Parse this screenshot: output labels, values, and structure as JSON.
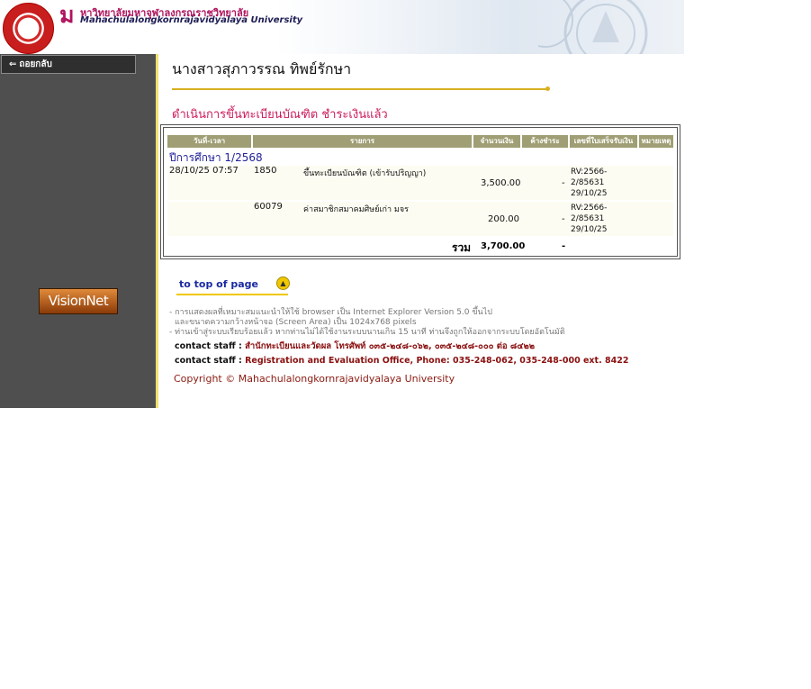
{
  "header": {
    "logo_mark": "ม",
    "university_thai": "หาวิทยาลัยมหาจุฬาลงกรณราชวิทยาลัย",
    "university_en": "Mahachulalongkornrajavidyalaya University"
  },
  "sidebar": {
    "back_label": "ถอยกลับ",
    "vision_label": "VisionNet"
  },
  "main": {
    "student_name": "นางสาวสุภาวรรณ ทิพย์รักษา",
    "status_title": "ดำเนินการขึ้นทะเบียนบัณฑิต ชำระเงินแล้ว"
  },
  "table": {
    "headers": [
      "วันที่-เวลา",
      "รายการ",
      "จำนวนเงิน",
      "ค้างชำระ",
      "เลขที่ใบเสร็จรับเงิน",
      "หมายเหตุ"
    ],
    "academic_year": "ปีการศึกษา 1/2568",
    "rows": [
      {
        "datetime": "28/10/25 07:57",
        "code": "1850",
        "description": "ขึ้นทะเบียนบัณฑิต (เข้ารับปริญญา)",
        "amount": "3,500.00",
        "outstanding": "-",
        "receipt_1": "RV:2566-",
        "receipt_2": "2/85631",
        "receipt_3": "29/10/25",
        "note": ""
      },
      {
        "datetime": "",
        "code": "60079",
        "description": "ค่าสมาชิกสมาคมศิษย์เก่า มจร",
        "amount": "200.00",
        "outstanding": "-",
        "receipt_1": "RV:2566-",
        "receipt_2": "2/85631",
        "receipt_3": "29/10/25",
        "note": ""
      }
    ],
    "total_label": "รวม",
    "total_amount": "3,700.00",
    "total_outstanding": "-"
  },
  "footer": {
    "to_top_label": "to top of page",
    "to_top_icon": "▲",
    "note_1": "- การแสดงผลที่เหมาะสมแนะนำให้ใช้ browser เป็น Internet Explorer Version 5.0 ขึ้นไป",
    "note_2": "และขนาดความกว้างหน้าจอ (Screen Area) เป็น 1024x768 pixels",
    "note_3": "- ท่านเข้าสู่ระบบเรียบร้อยแล้ว หากท่านไม่ได้ใช้งานระบบนานเกิน 15 นาที ท่านจึงถูกให้ออกจากระบบโดยอัตโนมัติ",
    "staff_label": "contact staff :",
    "staff_thai": "สำนักทะเบียนและวัดผล โทรศัพท์ ๐๓๕-๒๔๘-๐๖๒, ๐๓๕-๒๔๘-๐๐๐ ต่อ ๘๔๒๒",
    "staff_en": "Registration and Evaluation Office, Phone: 035-248-062, 035-248-000 ext. 8422",
    "copyright": "Copyright © Mahachulalongkornrajavidyalaya University"
  },
  "colors": {
    "sidebar_bg": "#4f4f4f",
    "header_cell": "#9f9e74",
    "accent_magenta": "#cc1a5a",
    "accent_gold": "#d8b020"
  }
}
